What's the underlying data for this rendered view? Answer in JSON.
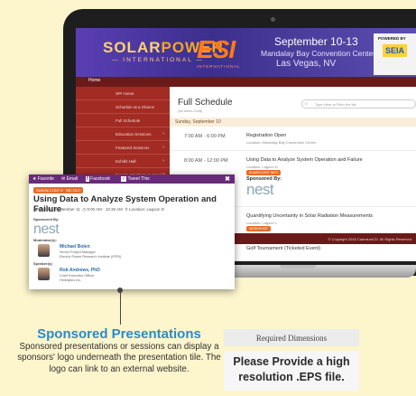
{
  "banner": {
    "logo_main_a": "SOLAR",
    "logo_main_b": "POWER",
    "logo_sub": "— INTERNATIONAL —",
    "logo_esi": "ESI",
    "logo_esi_sub": "INTERNATIONAL",
    "date_line1": "September 10-13",
    "date_line2": "Mandalay Bay Convention Center",
    "date_line3": "Las Vegas, NV",
    "powered_label": "POWERED BY",
    "powered_logo": "SEIA"
  },
  "nav": {
    "home": "Home"
  },
  "sidebar": {
    "items": [
      {
        "label": "SPI Home"
      },
      {
        "label": "Schedule at a Glance"
      },
      {
        "label": "Full Schedule"
      },
      {
        "label": "Education Sessions"
      },
      {
        "label": "Featured Sessions"
      },
      {
        "label": "Exhibit Hall"
      },
      {
        "label": "Events, Meetings & Special Sessions"
      }
    ]
  },
  "schedule": {
    "title": "Full Schedule",
    "subtitle": "(All times Gold)",
    "search_placeholder": "Type Here to Filter the list",
    "day_header": "Sunday, September 10",
    "rows": [
      {
        "time": "7:00 AM - 6:00 PM",
        "event": "Registration Open",
        "location": "Location: Mandalay Bay Convention Center"
      },
      {
        "time": "8:00 AM - 12:00 PM",
        "event": "Using Data to Analyze System Operation and Failure",
        "location": "Location: Lagoon D",
        "tag": "SUN/IN-CONT INFO",
        "sponsor_label": "Sponsored By:",
        "sponsor_logo": "nest"
      },
      {
        "event": "Quantifying Uncertainty in Solar Radiation Measurements",
        "location": "Location: Lagoon L",
        "tag": "WORKSHOP"
      },
      {
        "event": "Golf Tournament (Ticketed Event)"
      }
    ],
    "footer": "© Copyright 2018 CadmiumCD. All Rights Reserved."
  },
  "popup": {
    "actions": [
      "Favorite",
      "Email",
      "Facebook",
      "Tweet This"
    ],
    "close": "✖",
    "tags": [
      "SUN/IN-CONT INFO",
      "SEI 2017"
    ],
    "title": "Using Data to Analyze System Operation and Failure",
    "date": "Monday, September 11",
    "time": "8:00 AM - 10:30 AM",
    "location": "Location: Lagoon D",
    "sponsored_label": "Sponsored By:",
    "sponsor_logo": "nest",
    "moderators_label": "Moderator(s):",
    "moderator": {
      "name": "Michael Bolen",
      "role1": "Senior Project Manager",
      "role2": "Electric Power Research Institute (EPRI)"
    },
    "speakers_label": "Speaker(s):",
    "speaker": {
      "name": "Rob Andrews, PhD",
      "role1": "Chief Executive Officer",
      "role2": "Heliolytics Inc."
    }
  },
  "callout": {
    "heading": "Sponsored Presentations",
    "body": "Sponsored presentations or sessions can display a sponsors' logo underneath the presentation tile. The logo can link to an external website."
  },
  "requirements": {
    "heading": "Required Dimensions",
    "body": "Please Provide a high resolution .EPS file."
  },
  "colors": {
    "background": "#fdf5cc",
    "banner": "#4a3a9e",
    "sidebar": "#a22b23",
    "popup_bar": "#6a2a7a",
    "accent_blue": "#2d8ac7",
    "tag_orange": "#e46c2a"
  }
}
